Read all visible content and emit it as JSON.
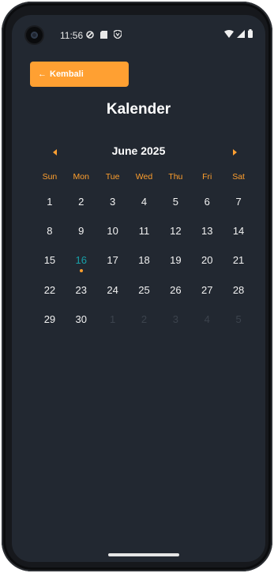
{
  "status_bar": {
    "time": "11:56",
    "left_icons": [
      "vpn-key-icon",
      "sd-card-icon",
      "shield-icon"
    ],
    "right_icons": [
      "wifi-icon",
      "signal-icon",
      "battery-icon"
    ]
  },
  "header": {
    "back_label": "Kembali",
    "title": "Kalender"
  },
  "calendar": {
    "month_label": "June 2025",
    "weekdays": [
      "Sun",
      "Mon",
      "Tue",
      "Wed",
      "Thu",
      "Fri",
      "Sat"
    ],
    "weeks": [
      [
        "1",
        "2",
        "3",
        "4",
        "5",
        "6",
        "7"
      ],
      [
        "8",
        "9",
        "10",
        "11",
        "12",
        "13",
        "14"
      ],
      [
        "15",
        "16",
        "17",
        "18",
        "19",
        "20",
        "21"
      ],
      [
        "22",
        "23",
        "24",
        "25",
        "26",
        "27",
        "28"
      ],
      [
        "29",
        "30",
        "1",
        "2",
        "3",
        "4",
        "5"
      ]
    ],
    "today": "16",
    "colors": {
      "accent": "#ffa032",
      "today": "#18a0a8",
      "background": "#222831",
      "faded": "#3c434d"
    }
  }
}
